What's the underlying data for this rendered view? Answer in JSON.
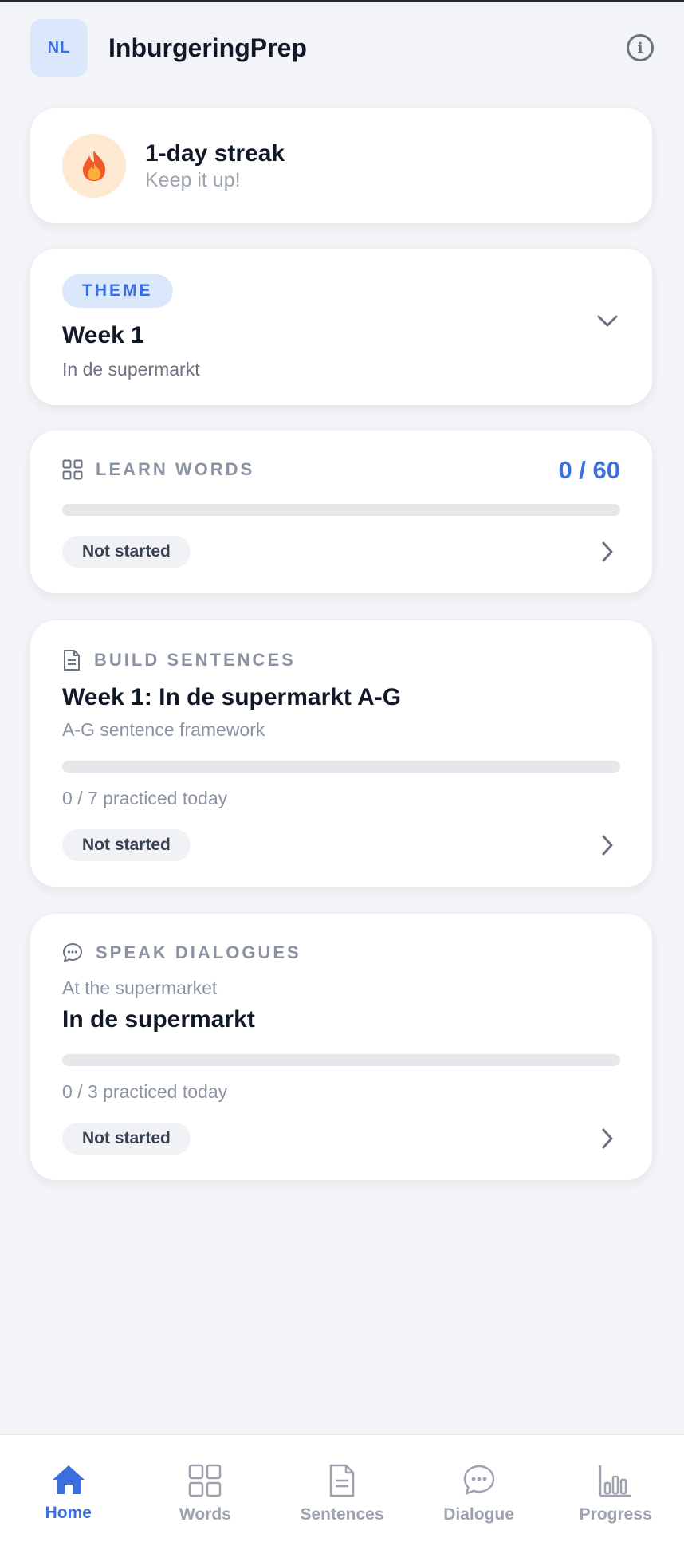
{
  "header": {
    "logo_text": "NL",
    "title": "InburgeringPrep",
    "info_icon": "info-icon"
  },
  "streak": {
    "title": "1-day streak",
    "subtitle": "Keep it up!",
    "icon": "flame-icon"
  },
  "theme": {
    "pill": "THEME",
    "title": "Week 1",
    "subtitle": "In de supermarkt"
  },
  "learn_words": {
    "label": "LEARN WORDS",
    "count": "0 / 60",
    "progress": 0,
    "status": "Not started"
  },
  "build_sentences": {
    "label": "BUILD SENTENCES",
    "title": "Week 1: In de supermarkt A-G",
    "subtitle": "A-G sentence framework",
    "progress": 0,
    "practiced": "0 / 7 practiced today",
    "status": "Not started"
  },
  "speak_dialogues": {
    "label": "SPEAK DIALOGUES",
    "subtitle": "At the supermarket",
    "title": "In de supermarkt",
    "progress": 0,
    "practiced": "0 / 3 practiced today",
    "status": "Not started"
  },
  "nav": {
    "items": [
      {
        "label": "Home",
        "icon": "home-icon",
        "active": true
      },
      {
        "label": "Words",
        "icon": "grid-icon",
        "active": false
      },
      {
        "label": "Sentences",
        "icon": "document-icon",
        "active": false
      },
      {
        "label": "Dialogue",
        "icon": "chat-bubble-icon",
        "active": false
      },
      {
        "label": "Progress",
        "icon": "bar-chart-icon",
        "active": false
      }
    ]
  },
  "colors": {
    "accent": "#3b6fe0",
    "background": "#f3f4f7",
    "muted": "#8a93a3"
  }
}
